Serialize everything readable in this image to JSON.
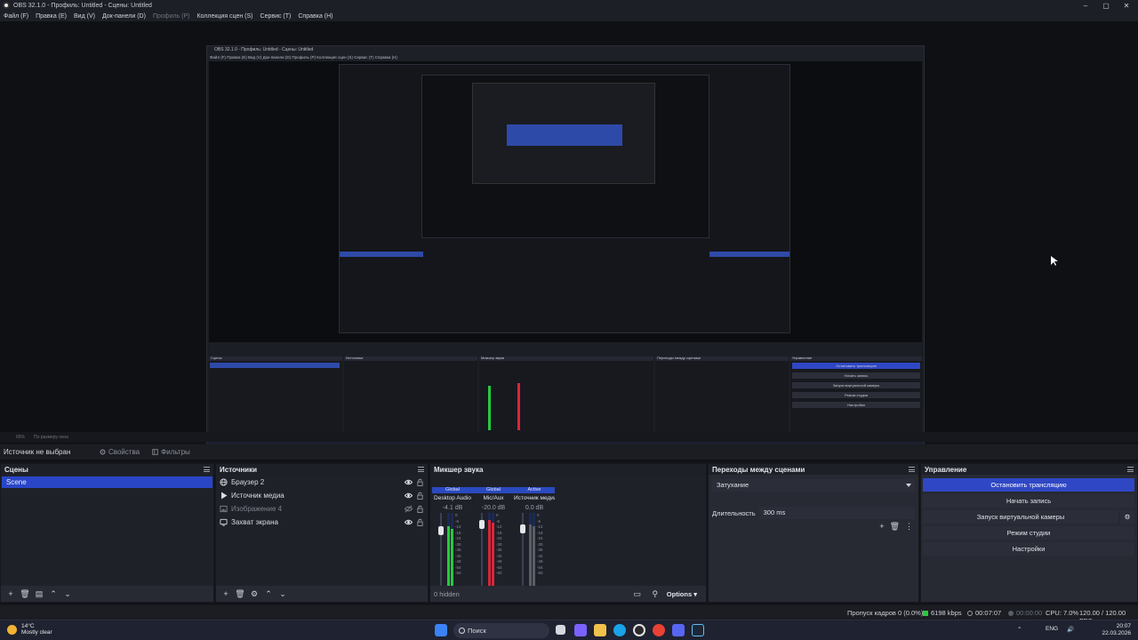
{
  "window": {
    "title": "OBS 32.1.0 - Профиль: Untitled - Сцены: Untitled",
    "controls": [
      "–",
      "▢",
      "✕"
    ]
  },
  "menu": {
    "file": "Файл (F)",
    "edit": "Правка (E)",
    "view": "Вид (V)",
    "docks": "Док-панели (D)",
    "profile": "Профиль (P)",
    "scene_collection": "Коллекция сцен (S)",
    "tools": "Сервис (T)",
    "help": "Справка (H)"
  },
  "preview_strip": {
    "zoom": "65%",
    "fit": "По размеру окна"
  },
  "context_bar": {
    "no_source": "Источник не выбран",
    "properties": "Свойства",
    "filters": "Фильтры"
  },
  "scenes": {
    "title": "Сцены",
    "items": [
      "Scene"
    ]
  },
  "sources": {
    "title": "Источники",
    "items": [
      {
        "label": "Браузер 2",
        "icon": "globe-icon",
        "visible": true
      },
      {
        "label": "Источник медиа",
        "icon": "play-icon",
        "visible": true
      },
      {
        "label": "Изображение 4",
        "icon": "image-icon",
        "visible": false
      },
      {
        "label": "Захват экрана",
        "icon": "monitor-icon",
        "visible": true
      }
    ]
  },
  "mixer": {
    "title": "Микшер звука",
    "channels": [
      {
        "tag": "Global",
        "name": "Desktop Audio",
        "db": "-4.1 dB",
        "level": 0.82,
        "color": "#27c93f"
      },
      {
        "tag": "Global",
        "name": "Mic/Aux",
        "db": "-20.0 dB",
        "level": 0.9,
        "color": "#d62839"
      },
      {
        "tag": "Active",
        "name": "Источник медиа",
        "db": "0.0 dB",
        "level": 0.85,
        "color": "#5a5d66"
      }
    ],
    "scale": [
      "0",
      "-6",
      "-12",
      "-18",
      "-24",
      "-30",
      "-36",
      "-42",
      "-48",
      "-54",
      "-60"
    ],
    "hidden": "0 hidden",
    "options": "Options"
  },
  "transitions": {
    "title": "Переходы между сценами",
    "selected": "Затухание",
    "duration_label": "Длительность",
    "duration": "300 ms"
  },
  "controls": {
    "title": "Управление",
    "stop_stream": "Остановить трансляцию",
    "start_record": "Начать запись",
    "virtual_cam": "Запуск виртуальной камеры",
    "studio_mode": "Режим студии",
    "settings": "Настройки"
  },
  "status": {
    "dropped": "Пропуск кадров 0 (0.0%)",
    "bitrate": "6198 kbps",
    "stream_time": "00:07:07",
    "record_time": "00:00:00",
    "cpu": "CPU: 7.0%",
    "fps": "120.00 / 120.00 FPS"
  },
  "nested_preview": {
    "title": "OBS 32.1.0 - Профиль: Untitled - Сцены: Untitled",
    "menu": "Файл (F)   Правка (E)   Вид (V)   Док-панели (D)   Профиль (P)   Коллекция сцен (S)   Сервис (T)   Справка (H)",
    "docks": [
      "Сцены",
      "Источники",
      "Микшер звука",
      "Переходы между сценами",
      "Управление"
    ],
    "buttons": [
      "Остановить трансляцию",
      "Начать запись",
      "Запуск виртуальной камеры",
      "Режим студии",
      "Настройки"
    ]
  },
  "taskbar": {
    "temp": "14°C",
    "weather": "Mostly clear",
    "search": "Поиск",
    "lang": "ENG",
    "time": "20:07",
    "date": "22.03.2026"
  },
  "colors": {
    "accent": "#2f47c4",
    "selection": "#2946c7",
    "meter_green": "#27c93f",
    "meter_red": "#d62839"
  }
}
